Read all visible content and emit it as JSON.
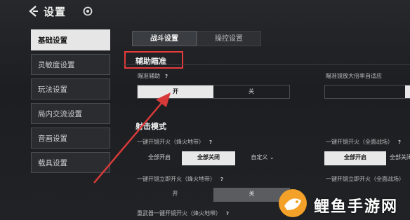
{
  "header": {
    "title": "设置"
  },
  "sidebar": {
    "items": [
      {
        "label": "基础设置",
        "active": true
      },
      {
        "label": "灵敏度设置",
        "active": false
      },
      {
        "label": "玩法设置",
        "active": false
      },
      {
        "label": "局内交流设置",
        "active": false
      },
      {
        "label": "音画设置",
        "active": false
      },
      {
        "label": "载具设置",
        "active": false
      }
    ]
  },
  "tabs": [
    {
      "label": "战斗设置",
      "active": true
    },
    {
      "label": "操控设置",
      "active": false
    }
  ],
  "aim_assist": {
    "section_title": "辅助瞄准",
    "aim_label": "瞄准辅助",
    "scope_label": "瞄准镜放大倍率自适应",
    "on": "开",
    "off": "关"
  },
  "fire_mode": {
    "section_title": "射击模式",
    "label1": "一键开镜开火（烽火地带）",
    "label1_right": "一键开镜开火（全面战场）",
    "all_on": "全部开启",
    "all_off": "全部关闭",
    "custom": "自定义",
    "label2": "一键开镜立即开火（烽火地带）",
    "label2_right": "一键开镜立即开火（全面战场）",
    "on": "开",
    "off": "关",
    "label3": "重武器一键开镜开火（烽火地带）"
  },
  "help_mark": "?",
  "watermark": {
    "text": "鲤鱼手游网"
  },
  "colors": {
    "highlight": "#e43b3b",
    "arrow": "#d83a3a",
    "selected": "#e8e8e8"
  }
}
